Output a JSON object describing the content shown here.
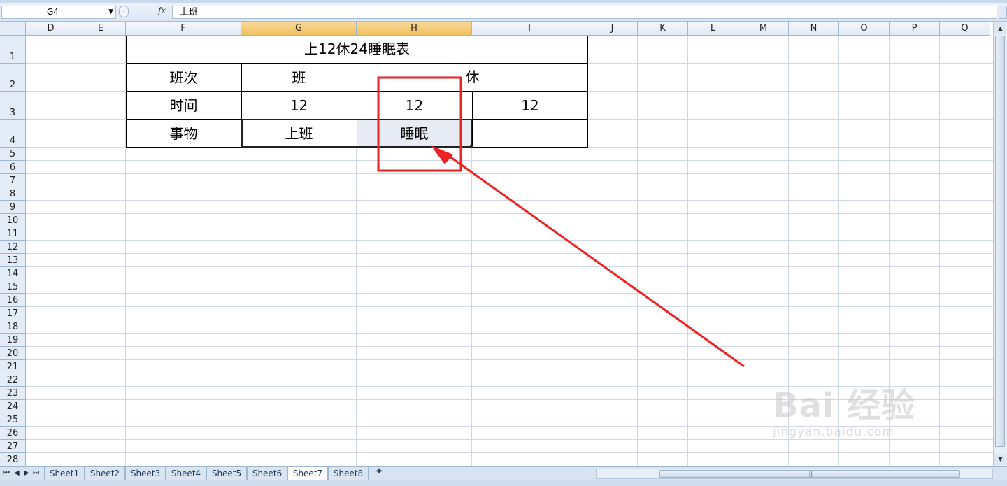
{
  "formula_bar": {
    "name_box": "G4",
    "fx_label": "fx",
    "content": "上班"
  },
  "columns": [
    "D",
    "E",
    "F",
    "G",
    "H",
    "I",
    "J",
    "K",
    "L",
    "M",
    "N",
    "O",
    "P",
    "Q"
  ],
  "rows": [
    "1",
    "2",
    "3",
    "4",
    "5",
    "6",
    "7",
    "8",
    "9",
    "10",
    "11",
    "12",
    "13",
    "14",
    "15",
    "16",
    "17",
    "18",
    "19",
    "20",
    "21",
    "22",
    "23",
    "24",
    "25",
    "26",
    "27",
    "28"
  ],
  "selected_columns": [
    "G",
    "H"
  ],
  "table": {
    "title": "上12休24睡眠表",
    "r2": {
      "label": "班次",
      "work": "班",
      "rest": "休"
    },
    "r3": {
      "label": "时间",
      "g": "12",
      "h": "12",
      "i": "12"
    },
    "r4": {
      "label": "事物",
      "g": "上班",
      "h": "睡眠",
      "i": ""
    }
  },
  "sheet_tabs": [
    "Sheet1",
    "Sheet2",
    "Sheet3",
    "Sheet4",
    "Sheet5",
    "Sheet6",
    "Sheet7",
    "Sheet8"
  ],
  "active_sheet": "Sheet7",
  "annotation_color": "#ee2222",
  "watermark": {
    "brand_text": "Bai  经验",
    "url": "jingyan.baidu.com"
  }
}
